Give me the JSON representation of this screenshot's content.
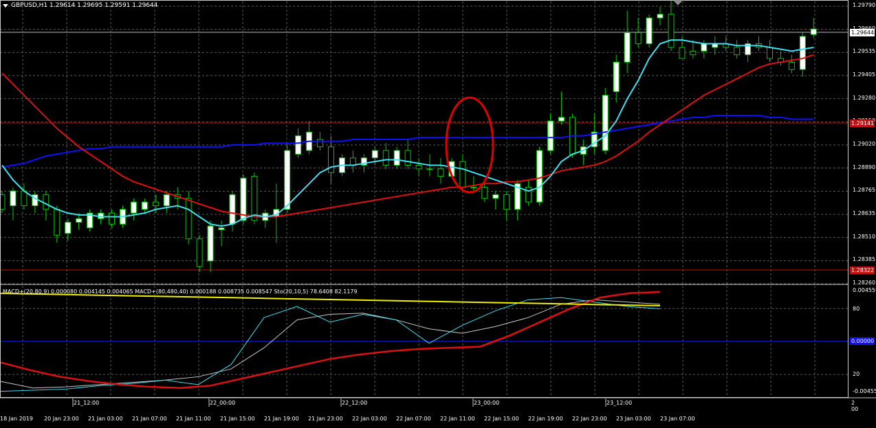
{
  "header": {
    "title": "GBPUSD,H1  1.29614 1.29695 1.29591 1.29644"
  },
  "indicator_header": "MACD+(20,80,9) 0.000080 0.004145 0.004065  MACD+(80,480,40) 0.000188 0.008735 0.008547  Sto(20,10,5) 78.6408 82.1179",
  "price_axis": {
    "labels": [
      "1.29790",
      "1.29660",
      "1.29535",
      "1.29405",
      "1.29280",
      "1.29150",
      "1.29020",
      "1.28890",
      "1.28765",
      "1.28635",
      "1.28510",
      "1.28385",
      "1.28260"
    ],
    "current_price": "1.29644",
    "level_high": "1.29141",
    "level_low": "1.28322"
  },
  "indicator_axis": {
    "labels": [
      "0.004559",
      "80",
      "20",
      "-0.00455"
    ],
    "zero_label": "0.00000"
  },
  "time_axis": {
    "major_labels": [
      "21_12:00",
      "22_00:00",
      "22_12:00",
      "23_00:00",
      "23_12:00"
    ],
    "minor_labels": [
      "18 Jan 2019",
      "20 Jan 23:00",
      "21 Jan 03:00",
      "21 Jan 07:00",
      "21 Jan 11:00",
      "21 Jan 15:00",
      "21 Jan 19:00",
      "21 Jan 23:00",
      "22 Jan 03:00",
      "22 Jan 07:00",
      "22 Jan 11:00",
      "22 Jan 15:00",
      "22 Jan 19:00",
      "22 Jan 23:00",
      "23 Jan 03:00",
      "23 Jan 07:00"
    ],
    "bottom_right_label": "2\n00"
  },
  "colors": {
    "background": "#000000",
    "grid": "#5a5a5a",
    "bull": "#ffffff",
    "bear": "#000000",
    "wick": "#00c800",
    "ma_fast": "#40e0f0",
    "ma_mid": "#e01010",
    "ma_slow": "#1010ff",
    "level_line": "#c01010",
    "annotation": "#e00000",
    "ind_yellow": "#f0f000",
    "ind_white": "#c8c8c8"
  },
  "chart_data": {
    "type": "candlestick",
    "symbol": "GBPUSD",
    "timeframe": "H1",
    "ylim": [
      1.2826,
      1.2979
    ],
    "candles": [
      [
        1.2874,
        1.2876,
        1.2864,
        1.2866
      ],
      [
        1.2868,
        1.2878,
        1.286,
        1.2876
      ],
      [
        1.2876,
        1.288,
        1.2866,
        1.2868
      ],
      [
        1.2868,
        1.2876,
        1.2864,
        1.2874
      ],
      [
        1.2874,
        1.2876,
        1.286,
        1.2866
      ],
      [
        1.2866,
        1.2868,
        1.2848,
        1.2852
      ],
      [
        1.2853,
        1.2861,
        1.2849,
        1.2859
      ],
      [
        1.2859,
        1.2864,
        1.2855,
        1.2861
      ],
      [
        1.2856,
        1.2866,
        1.2854,
        1.2864
      ],
      [
        1.2861,
        1.2866,
        1.2858,
        1.2864
      ],
      [
        1.2864,
        1.2866,
        1.2856,
        1.2858
      ],
      [
        1.2858,
        1.2868,
        1.2856,
        1.2866
      ],
      [
        1.2864,
        1.2872,
        1.286,
        1.287
      ],
      [
        1.2866,
        1.2872,
        1.2864,
        1.287
      ],
      [
        1.287,
        1.2874,
        1.2864,
        1.2868
      ],
      [
        1.2868,
        1.2876,
        1.2864,
        1.2874
      ],
      [
        1.2874,
        1.2878,
        1.2866,
        1.2872
      ],
      [
        1.2872,
        1.2876,
        1.2847,
        1.285
      ],
      [
        1.285,
        1.2852,
        1.2832,
        1.2835
      ],
      [
        1.2838,
        1.286,
        1.2832,
        1.2857
      ],
      [
        1.2855,
        1.286,
        1.2846,
        1.2856
      ],
      [
        1.2858,
        1.2876,
        1.2854,
        1.2874
      ],
      [
        1.286,
        1.2885,
        1.2858,
        1.2883
      ],
      [
        1.2884,
        1.2886,
        1.2858,
        1.286
      ],
      [
        1.286,
        1.2866,
        1.2856,
        1.2864
      ],
      [
        1.2862,
        1.288,
        1.2848,
        1.2866
      ],
      [
        1.2866,
        1.2902,
        1.2864,
        1.2898
      ],
      [
        1.2896,
        1.291,
        1.2894,
        1.2906
      ],
      [
        1.2898,
        1.2914,
        1.2896,
        1.2908
      ],
      [
        1.2904,
        1.2908,
        1.2898,
        1.29
      ],
      [
        1.29,
        1.2906,
        1.288,
        1.2886
      ],
      [
        1.2886,
        1.2896,
        1.2884,
        1.2894
      ],
      [
        1.2894,
        1.2898,
        1.2886,
        1.289
      ],
      [
        1.289,
        1.2896,
        1.2886,
        1.2894
      ],
      [
        1.2894,
        1.29,
        1.289,
        1.2898
      ],
      [
        1.2898,
        1.2902,
        1.2888,
        1.289
      ],
      [
        1.289,
        1.29,
        1.2888,
        1.2898
      ],
      [
        1.2898,
        1.2904,
        1.2888,
        1.289
      ],
      [
        1.289,
        1.2894,
        1.2884,
        1.2888
      ],
      [
        1.2888,
        1.2896,
        1.2884,
        1.2888
      ],
      [
        1.2888,
        1.2894,
        1.288,
        1.2884
      ],
      [
        1.2884,
        1.2894,
        1.2884,
        1.2892
      ],
      [
        1.2892,
        1.2896,
        1.2876,
        1.2878
      ],
      [
        1.2878,
        1.2884,
        1.2876,
        1.2878
      ],
      [
        1.2878,
        1.288,
        1.287,
        1.2872
      ],
      [
        1.2872,
        1.2876,
        1.2866,
        1.2874
      ],
      [
        1.2874,
        1.2876,
        1.286,
        1.2866
      ],
      [
        1.2866,
        1.2882,
        1.286,
        1.288
      ],
      [
        1.2878,
        1.2882,
        1.2868,
        1.287
      ],
      [
        1.287,
        1.29,
        1.2868,
        1.2898
      ],
      [
        1.2898,
        1.2918,
        1.2896,
        1.2914
      ],
      [
        1.2914,
        1.293,
        1.2912,
        1.2916
      ],
      [
        1.2916,
        1.2918,
        1.2894,
        1.2896
      ],
      [
        1.2896,
        1.2904,
        1.289,
        1.29
      ],
      [
        1.29,
        1.2918,
        1.2896,
        1.2908
      ],
      [
        1.2898,
        1.2932,
        1.2896,
        1.2928
      ],
      [
        1.293,
        1.295,
        1.2924,
        1.2946
      ],
      [
        1.2946,
        1.2974,
        1.294,
        1.2962
      ],
      [
        1.2962,
        1.297,
        1.2954,
        1.2956
      ],
      [
        1.2956,
        1.2972,
        1.2954,
        1.297
      ],
      [
        1.297,
        1.2976,
        1.2966,
        1.2972
      ],
      [
        1.2972,
        1.2982,
        1.2952,
        1.2954
      ],
      [
        1.2954,
        1.296,
        1.2948,
        1.2948
      ],
      [
        1.2952,
        1.2958,
        1.2948,
        1.295
      ],
      [
        1.2952,
        1.2958,
        1.2948,
        1.2956
      ],
      [
        1.2954,
        1.296,
        1.295,
        1.2956
      ],
      [
        1.2956,
        1.296,
        1.2952,
        1.2954
      ],
      [
        1.2954,
        1.2958,
        1.2948,
        1.295
      ],
      [
        1.295,
        1.2958,
        1.2946,
        1.2956
      ],
      [
        1.2956,
        1.296,
        1.2952,
        1.2954
      ],
      [
        1.2954,
        1.2958,
        1.2946,
        1.2948
      ],
      [
        1.2948,
        1.2952,
        1.2944,
        1.2946
      ],
      [
        1.2946,
        1.295,
        1.294,
        1.2942
      ],
      [
        1.2942,
        1.2962,
        1.2938,
        1.296
      ],
      [
        1.2961,
        1.297,
        1.2959,
        1.2964
      ]
    ],
    "ma_fast": [
      1.289,
      1.2882,
      1.2876,
      1.2872,
      1.2869,
      1.2866,
      1.2864,
      1.2863,
      1.2863,
      1.2862,
      1.2862,
      1.2862,
      1.2863,
      1.2864,
      1.2866,
      1.2867,
      1.2868,
      1.2866,
      1.2862,
      1.2858,
      1.2857,
      1.2858,
      1.2861,
      1.2863,
      1.2862,
      1.2863,
      1.2868,
      1.2874,
      1.288,
      1.2886,
      1.2889,
      1.289,
      1.289,
      1.2891,
      1.2892,
      1.2893,
      1.2893,
      1.2892,
      1.2891,
      1.289,
      1.289,
      1.2889,
      1.2888,
      1.2886,
      1.2884,
      1.2882,
      1.288,
      1.2878,
      1.2876,
      1.2878,
      1.2884,
      1.2892,
      1.2896,
      1.2898,
      1.2902,
      1.2906,
      1.2914,
      1.2926,
      1.2936,
      1.2948,
      1.2956,
      1.2958,
      1.2958,
      1.2957,
      1.2956,
      1.2956,
      1.2956,
      1.2955,
      1.2955,
      1.2955,
      1.2954,
      1.2953,
      1.2952,
      1.2953,
      1.2954
    ],
    "ma_mid": [
      1.294,
      1.2934,
      1.2928,
      1.2922,
      1.2916,
      1.291,
      1.2905,
      1.29,
      1.2896,
      1.2892,
      1.2888,
      1.2884,
      1.2881,
      1.2879,
      1.2877,
      1.2875,
      1.2873,
      1.2871,
      1.2869,
      1.2867,
      1.2865,
      1.2864,
      1.2863,
      1.2862,
      1.2862,
      1.2862,
      1.2863,
      1.2864,
      1.2865,
      1.2866,
      1.2867,
      1.2868,
      1.2869,
      1.287,
      1.2871,
      1.2872,
      1.2873,
      1.2874,
      1.2875,
      1.2876,
      1.2877,
      1.2878,
      1.2878,
      1.2879,
      1.288,
      1.288,
      1.2881,
      1.2881,
      1.2882,
      1.2883,
      1.2885,
      1.2887,
      1.2888,
      1.2889,
      1.289,
      1.2892,
      1.2895,
      1.2899,
      1.2903,
      1.2908,
      1.2912,
      1.2916,
      1.292,
      1.2924,
      1.2928,
      1.2931,
      1.2934,
      1.2937,
      1.294,
      1.2943,
      1.2945,
      1.2946,
      1.2947,
      1.2948,
      1.295
    ],
    "ma_slow": [
      1.2889,
      1.289,
      1.2891,
      1.2893,
      1.2895,
      1.2896,
      1.2897,
      1.2898,
      1.2899,
      1.2899,
      1.29,
      1.29,
      1.29,
      1.29,
      1.29,
      1.29,
      1.29,
      1.29,
      1.29,
      1.29,
      1.29,
      1.2901,
      1.2901,
      1.2901,
      1.2902,
      1.2902,
      1.2902,
      1.2902,
      1.2903,
      1.2903,
      1.2903,
      1.2903,
      1.2904,
      1.2904,
      1.2904,
      1.2904,
      1.2904,
      1.2904,
      1.2905,
      1.2905,
      1.2905,
      1.2905,
      1.2905,
      1.2905,
      1.2905,
      1.2905,
      1.2905,
      1.2905,
      1.2905,
      1.2905,
      1.2905,
      1.2905,
      1.2906,
      1.2906,
      1.2907,
      1.2908,
      1.2909,
      1.291,
      1.2911,
      1.2912,
      1.2913,
      1.2914,
      1.2915,
      1.2916,
      1.2916,
      1.2917,
      1.2917,
      1.2917,
      1.2917,
      1.2917,
      1.2916,
      1.2916,
      1.2915,
      1.2915,
      1.2915
    ],
    "levels": [
      1.29141,
      1.28322
    ],
    "indicator": {
      "range": [
        -0.00455,
        0.004559
      ],
      "yellow": [
        0.0044,
        0.00438,
        0.00436,
        0.00434,
        0.00432,
        0.0043,
        0.00428,
        0.00426,
        0.00424,
        0.00422,
        0.0042,
        0.00418,
        0.00416,
        0.00414,
        0.00412,
        0.0041,
        0.00408,
        0.00406,
        0.00404,
        0.00402,
        0.00401
      ],
      "red": [
        -0.0018,
        -0.0025,
        -0.0031,
        -0.0035,
        -0.0038,
        -0.004,
        -0.0041,
        -0.0039,
        -0.0033,
        -0.0027,
        -0.0021,
        -0.0015,
        -0.0011,
        -0.0008,
        -0.0006,
        -0.0005,
        -0.0004,
        0.0006,
        0.0018,
        0.003,
        0.004,
        0.0044,
        0.0045
      ],
      "cyan": [
        -0.0044,
        -0.0043,
        -0.0042,
        -0.0039,
        -0.0037,
        -0.0034,
        -0.0038,
        -0.002,
        0.0022,
        0.0032,
        0.0018,
        0.0025,
        0.002,
        -0.0001,
        0.0015,
        0.0028,
        0.0038,
        0.004,
        0.0036,
        0.0032,
        0.003
      ],
      "white": [
        -0.0035,
        -0.0041,
        -0.004,
        -0.0038,
        -0.0036,
        -0.0034,
        -0.0031,
        -0.0024,
        -0.0005,
        0.002,
        0.0025,
        0.0026,
        0.002,
        0.0012,
        0.0008,
        0.0014,
        0.0022,
        0.0034,
        0.0038,
        0.0036,
        0.0034
      ]
    }
  }
}
